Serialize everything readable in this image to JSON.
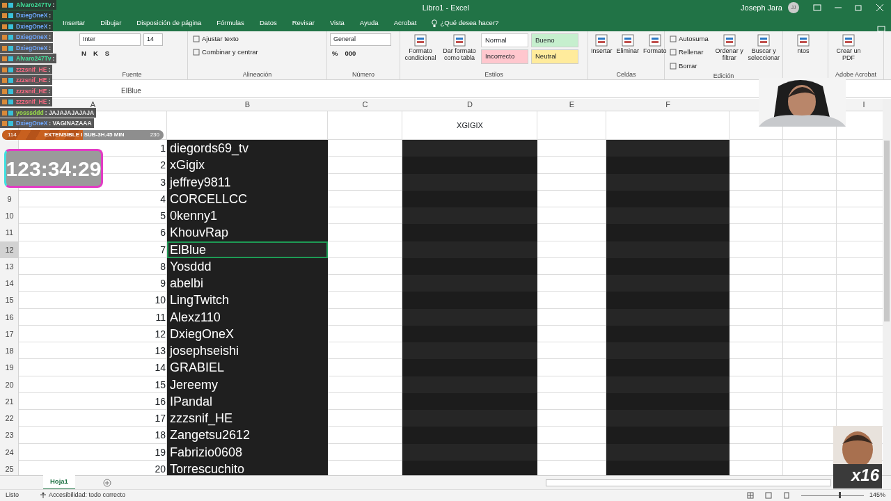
{
  "window": {
    "title": "Libro1 - Excel",
    "user": "Joseph Jara",
    "avatar": "JJ"
  },
  "tabs": [
    "Insertar",
    "Dibujar",
    "Disposición de página",
    "Fórmulas",
    "Datos",
    "Revisar",
    "Vista",
    "Ayuda",
    "Acrobat"
  ],
  "tell_me": "¿Qué desea hacer?",
  "ribbon": [
    {
      "label": "Fuente",
      "columns": [
        {
          "kind": "stack",
          "lines": [
            [
              {
                "kind": "field",
                "text": "Inter"
              },
              {
                "kind": "field",
                "text": "14"
              }
            ],
            [
              {
                "kind": "glyph",
                "text": "N"
              },
              {
                "kind": "glyph",
                "text": "K"
              },
              {
                "kind": "glyph",
                "text": "S"
              }
            ]
          ]
        }
      ]
    },
    {
      "label": "Alineación",
      "columns": [
        {
          "kind": "stack",
          "lines": [
            [
              {
                "kind": "button",
                "text": "Ajustar texto"
              }
            ],
            [
              {
                "kind": "button",
                "text": "Combinar y centrar"
              }
            ]
          ]
        }
      ]
    },
    {
      "label": "Número",
      "columns": [
        {
          "kind": "stack",
          "lines": [
            [
              {
                "kind": "field",
                "text": "General"
              }
            ],
            [
              {
                "kind": "glyph",
                "text": "%"
              },
              {
                "kind": "glyph",
                "text": "000"
              }
            ]
          ]
        }
      ]
    },
    {
      "label": "Estilos",
      "columns": [
        {
          "kind": "big",
          "text": "Formato condicional"
        },
        {
          "kind": "big",
          "text": "Dar formato como tabla"
        },
        {
          "kind": "stack",
          "lines": [
            [
              {
                "kind": "style",
                "text": "Normal",
                "color": "#ffffff"
              },
              {
                "kind": "style",
                "text": "Bueno",
                "color": "#c6efce"
              }
            ],
            [
              {
                "kind": "style",
                "text": "Incorrecto",
                "color": "#ffc7ce"
              },
              {
                "kind": "style",
                "text": "Neutral",
                "color": "#ffeb9c"
              }
            ]
          ]
        }
      ]
    },
    {
      "label": "Celdas",
      "columns": [
        {
          "kind": "big",
          "text": "Insertar"
        },
        {
          "kind": "big",
          "text": "Eliminar"
        },
        {
          "kind": "big",
          "text": "Formato"
        }
      ]
    },
    {
      "label": "Edición",
      "columns": [
        {
          "kind": "stack",
          "lines": [
            [
              {
                "kind": "button",
                "text": "Autosuma"
              }
            ],
            [
              {
                "kind": "button",
                "text": "Rellenar"
              }
            ],
            [
              {
                "kind": "button",
                "text": "Borrar"
              }
            ]
          ]
        },
        {
          "kind": "big",
          "text": "Ordenar y filtrar"
        },
        {
          "kind": "big",
          "text": "Buscar y seleccionar"
        }
      ]
    },
    {
      "columns": [
        {
          "kind": "big",
          "text": "ntos"
        }
      ]
    },
    {
      "label": "Adobe Acrobat",
      "columns": [
        {
          "kind": "big",
          "text": "Crear un PDF"
        }
      ]
    }
  ],
  "formula_bar": {
    "formula": "ElBlue"
  },
  "columns": [
    "A",
    "B",
    "C",
    "D",
    "E",
    "F",
    "",
    "",
    "I"
  ],
  "header_row": {
    "D": "XGIGIX"
  },
  "rows": [
    {
      "index": "1",
      "name": "diegords69_tv",
      "selected": false
    },
    {
      "index": "2",
      "name": "xGigix",
      "selected": false
    },
    {
      "index": "3",
      "name": "jeffrey9811",
      "selected": false
    },
    {
      "number": "9",
      "index": "4",
      "name": "CORCELLCC",
      "selected": false
    },
    {
      "number": "10",
      "index": "5",
      "name": "0kenny1",
      "selected": false
    },
    {
      "number": "11",
      "index": "6",
      "name": "KhouvRap",
      "selected": false
    },
    {
      "number": "12",
      "index": "7",
      "name": "ElBlue",
      "selected": true
    },
    {
      "number": "13",
      "index": "8",
      "name": "Yosddd",
      "selected": false
    },
    {
      "number": "14",
      "index": "9",
      "name": "abelbi",
      "selected": false
    },
    {
      "number": "15",
      "index": "10",
      "name": "LingTwitch",
      "selected": false
    },
    {
      "number": "16",
      "index": "11",
      "name": "Alexz110",
      "selected": false
    },
    {
      "number": "17",
      "index": "12",
      "name": "DxiegOneX",
      "selected": false
    },
    {
      "number": "18",
      "index": "13",
      "name": "josephseishi",
      "selected": false
    },
    {
      "number": "19",
      "index": "14",
      "name": "GRABIEL",
      "selected": false
    },
    {
      "number": "20",
      "index": "15",
      "name": "Jereemy",
      "selected": false
    },
    {
      "number": "21",
      "index": "16",
      "name": "IPandal",
      "selected": false
    },
    {
      "number": "22",
      "index": "17",
      "name": "zzzsnif_HE",
      "selected": false
    },
    {
      "number": "23",
      "index": "18",
      "name": "Zangetsu2612",
      "selected": false
    },
    {
      "number": "24",
      "index": "19",
      "name": "Fabrizio0608",
      "selected": false
    },
    {
      "number": "25",
      "index": "20",
      "name": "Torrescuchito",
      "selected": false
    }
  ],
  "sheet_tabs": [
    {
      "label": "Hoja1",
      "selected": true
    }
  ],
  "status_bar": {
    "left": "Listo",
    "accessibility": "Accesibilidad: todo correcto",
    "zoom": "145%",
    "zoom_slider": {
      "level": 0.6
    }
  },
  "chat": [
    {
      "user": "Alvaro247Tv",
      "message": ":",
      "color": "#3fe09a"
    },
    {
      "user": "DxiegOneX",
      "message": ":",
      "color": "#6fa8ff"
    },
    {
      "user": "DxiegOneX",
      "message": ":",
      "color": "#6fa8ff"
    },
    {
      "user": "DxiegOneX",
      "message": ":",
      "color": "#6fa8ff"
    },
    {
      "user": "DxiegOneX",
      "message": ":",
      "color": "#6fa8ff"
    },
    {
      "user": "Alvaro247Tv",
      "message": ":",
      "color": "#3fe09a"
    },
    {
      "user": "zzzsnif_HE",
      "message": ":",
      "color": "#ff6b84"
    },
    {
      "user": "zzzsnif_HE",
      "message": ":",
      "color": "#ff6b84"
    },
    {
      "user": "zzzsnif_HE",
      "message": ":",
      "color": "#ff6b84"
    },
    {
      "user": "zzzsnif_HE",
      "message": ":",
      "color": "#ff6b84"
    },
    {
      "user": "yosssddd",
      "message": ": JAJAJAJAJAJA",
      "color": "#9be04a"
    },
    {
      "user": "DxiegOneX",
      "message": ": VAGINAZAAA",
      "color": "#6fa8ff"
    }
  ],
  "sub_goal": {
    "current": "114",
    "label": "EXTENSIBLE I SUB-3H.45 MIN",
    "target": "230",
    "level": 0.5
  },
  "timer": "123:34:29",
  "emote": {
    "count": "x16"
  }
}
